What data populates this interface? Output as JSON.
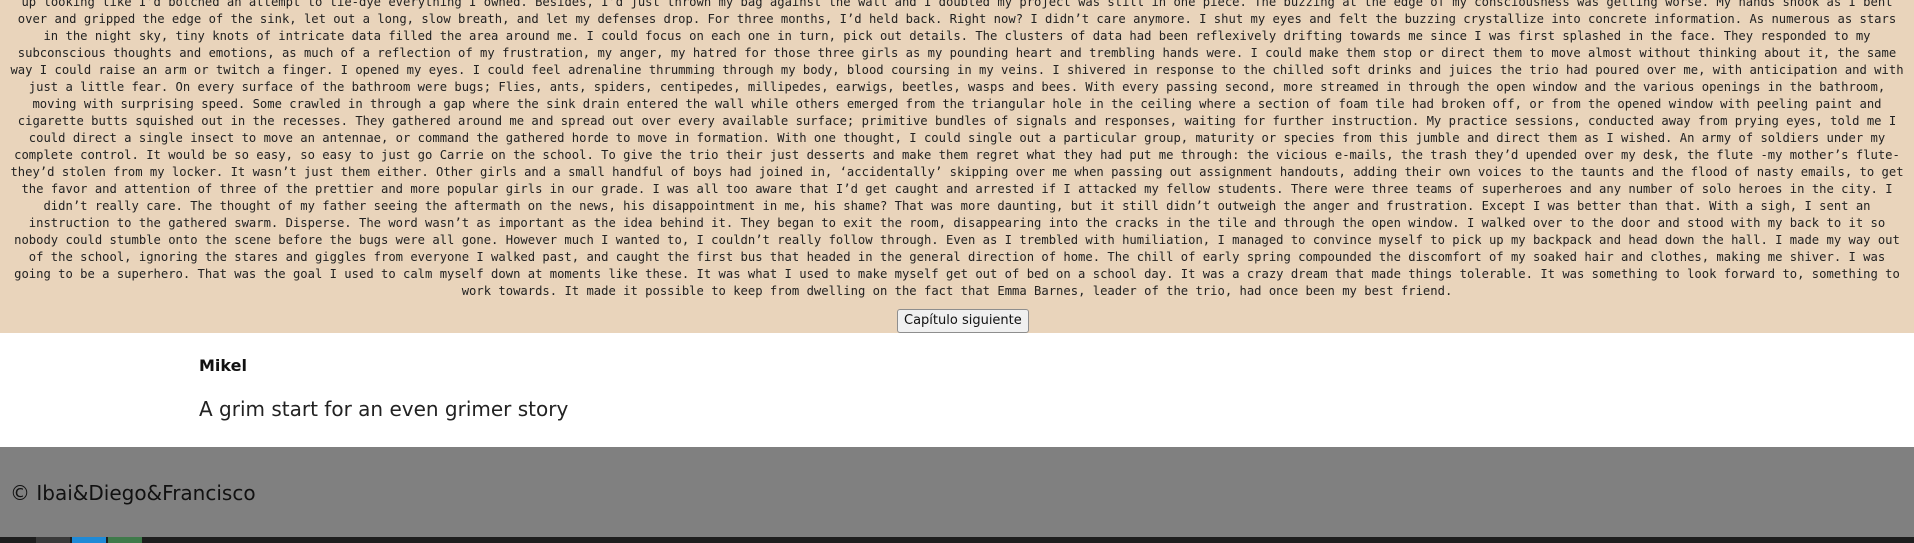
{
  "chapter": {
    "text": "up looking like I’d botched an attempt to tie-dye everything I owned. Besides, I’d just thrown my bag against the wall and I doubted my project was still in one piece. The buzzing at the edge of my consciousness was getting worse. My hands shook as I bent over and gripped the edge of the sink, let out a long, slow breath, and let my defenses drop. For three months, I’d held back. Right now? I didn’t care anymore. I shut my eyes and felt the buzzing crystallize into concrete information. As numerous as stars in the night sky, tiny knots of intricate data filled the area around me. I could focus on each one in turn, pick out details. The clusters of data had been reflexively drifting towards me since I was first splashed in the face. They responded to my subconscious thoughts and emotions, as much of a reflection of my frustration, my anger, my hatred for those three girls as my pounding heart and trembling hands were. I could make them stop or direct them to move almost without thinking about it, the same way I could raise an arm or twitch a finger. I opened my eyes. I could feel adrenaline thrumming through my body, blood coursing in my veins. I shivered in response to the chilled soft drinks and juices the trio had poured over me, with anticipation and with just a little fear. On every surface of the bathroom were bugs; Flies, ants, spiders, centipedes, millipedes, earwigs, beetles, wasps and bees. With every passing second, more streamed in through the open window and the various openings in the bathroom, moving with surprising speed. Some crawled in through a gap where the sink drain entered the wall while others emerged from the triangular hole in the ceiling where a section of foam tile had broken off, or from the opened window with peeling paint and cigarette butts squished out in the recesses. They gathered around me and spread out over every available surface; primitive bundles of signals and responses, waiting for further instruction. My practice sessions, conducted away from prying eyes, told me I could direct a single insect to move an antennae, or command the gathered horde to move in formation. With one thought, I could single out a particular group, maturity or species from this jumble and direct them as I wished. An army of soldiers under my complete control. It would be so easy, so easy to just go Carrie on the school. To give the trio their just desserts and make them regret what they had put me through: the vicious e-mails, the trash they’d upended over my desk, the flute -my mother’s flute- they’d stolen from my locker. It wasn’t just them either. Other girls and a small handful of boys had joined in, ‘accidentally’ skipping over me when passing out assignment handouts, adding their own voices to the taunts and the flood of nasty emails, to get the favor and attention of three of the prettier and more popular girls in our grade. I was all too aware that I’d get caught and arrested if I attacked my fellow students. There were three teams of superheroes and any number of solo heroes in the city. I didn’t really care. The thought of my father seeing the aftermath on the news, his disappointment in me, his shame? That was more daunting, but it still didn’t outweigh the anger and frustration. Except I was better than that. With a sigh, I sent an instruction to the gathered swarm. Disperse. The word wasn’t as important as the idea behind it. They began to exit the room, disappearing into the cracks in the tile and through the open window. I walked over to the door and stood with my back to it so nobody could stumble onto the scene before the bugs were all gone. However much I wanted to, I couldn’t really follow through. Even as I trembled with humiliation, I managed to convince myself to pick up my backpack and head down the hall. I made my way out of the school, ignoring the stares and giggles from everyone I walked past, and caught the first bus that headed in the general direction of home. The chill of early spring compounded the discomfort of my soaked hair and clothes, making me shiver. I was going to be a superhero. That was the goal I used to calm myself down at moments like these. It was what I used to make myself get out of bed on a school day. It was a crazy dream that made things tolerable. It was something to look forward to, something to work towards. It made it possible to keep from dwelling on the fact that Emma Barnes, leader of the trio, had once been my best friend.",
    "next_button_label": "Capítulo siguiente"
  },
  "comment": {
    "author": "Mikel",
    "body": "A grim start for an even grimer story"
  },
  "footer": {
    "copyright": "© Ibai&Diego&Francisco"
  },
  "colors": {
    "chapter_bg": "#e9d4bb",
    "footer_bg": "#808080",
    "taskbar_bg": "#1e1e1e"
  }
}
